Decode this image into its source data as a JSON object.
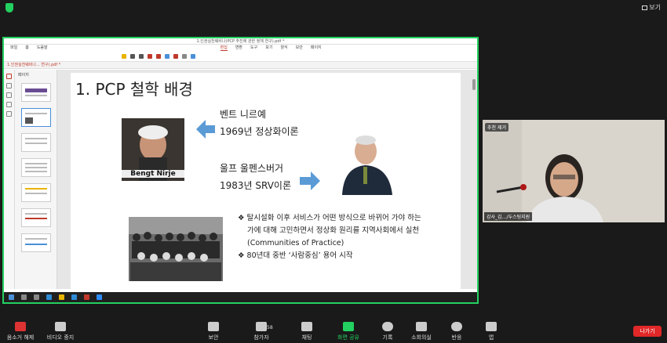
{
  "zoom": {
    "view_label": "보기",
    "controls": {
      "mute": "음소거 해제",
      "video": "비디오 중지",
      "security": "보안",
      "participants": "참가자",
      "participants_count": "58",
      "chat": "채팅",
      "share": "화면 공유",
      "record": "기록",
      "breakout": "소회의실",
      "reactions": "반응",
      "apps": "앱",
      "leave": "나가기"
    }
  },
  "pdf_viewer": {
    "menu": [
      "파일",
      "홈",
      "도움말",
      "편집",
      "변환",
      "도구",
      "보기",
      "양식",
      "보안",
      "페이지"
    ],
    "active_menu": "편집",
    "title_text": "1.인권실천웨비나(PCP 추진에 관한 정책 연구).pdf *",
    "tab": "1.인권실천웨비나... 연구).pdf *",
    "thumbs_header": "페이지"
  },
  "slide": {
    "title": "1. PCP 철학 배경",
    "person1_label": "Bengt Nirje",
    "person1_name": "벤트 니르예",
    "person1_theory": "1969년 정상화이론",
    "person2_name": "울프 울펜스버거",
    "person2_theory": "1983년 SRV이론",
    "bullets": [
      "❖ 탈시설화 이후 서비스가 어떤 방식으로 바뀌어 가야 하는가에 대해 고민하면서 정상화 원리를 지역사회에서 실천 (Communities of  Practice)",
      "❖ 80년대 중반 ‘사람중심’ 용어 시작"
    ]
  },
  "video_tile": {
    "badge": "추천 제거",
    "name": "강사_김…/두스팅지원"
  }
}
